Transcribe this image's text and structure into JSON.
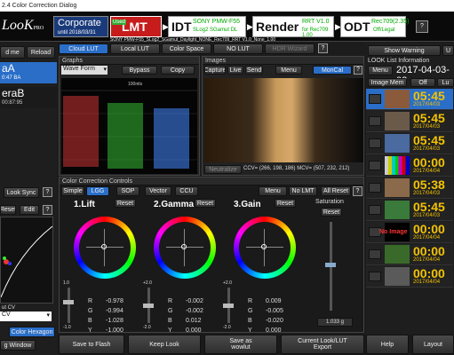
{
  "window": {
    "title": "2.4 Color Correction Dialog"
  },
  "header": {
    "logo": "LooK",
    "logo_suffix": "PRO",
    "product": "Corporate",
    "until": "until 2018/03/31",
    "lmt": {
      "label": "LMT",
      "badge": "Used",
      "value": "Neutral"
    },
    "idt": {
      "label": "IDT",
      "value": "SONY PMW-F55",
      "sub": "SLog2 SGamut DL"
    },
    "render": {
      "label": "Render",
      "value": "RRT V1.0",
      "sub": "for Rec709 1.00"
    },
    "odt": {
      "label": "ODT",
      "value": "Rec709(2.35)",
      "sub": "Off/Legal"
    },
    "path": "SONY PMW-F55_SLog2_SGamut_Daylight_NONE_Rec709_RRT V1.0_None_1.00",
    "help_glyph": "?"
  },
  "left": {
    "buttons": [
      "d me",
      "Reload"
    ],
    "items": [
      {
        "name": "aA",
        "tc": "0:47 BA"
      },
      {
        "name": "eraB",
        "tc": "00:87:95"
      }
    ],
    "look_sync": "Look Sync",
    "reset": "Reset",
    "edit": "Edit",
    "select_value": "CV",
    "color_hexagon": "Color Hexagon",
    "window_label": "g Window",
    "curve_label": "ut CV"
  },
  "tabs": [
    {
      "label": "Cloud LUT"
    },
    {
      "label": "Local LUT"
    },
    {
      "label": "Color Space"
    },
    {
      "label": "NO LUT"
    },
    {
      "label": "HDR Wizard"
    }
  ],
  "graphs": {
    "title": "Graphs",
    "type": "Wave Form",
    "bypass": "Bypass",
    "copy": "Copy",
    "scale": "100nits"
  },
  "images": {
    "title": "Images",
    "capture": "Capture",
    "live": "Live",
    "send": "Send",
    "menu": "Menu",
    "moncal": "MonCal",
    "neutralize": "Neutralize",
    "ccv": "CCV= (266, 198, 186) MCV= (507, 232, 212)"
  },
  "cc": {
    "title": "Color Correction Controls",
    "tabs": [
      "Simple",
      "LGG",
      "SOP",
      "Vector",
      "CCU"
    ],
    "menu": "Menu",
    "no_lmt": "No LMT",
    "all_reset": "All Reset",
    "wheels": [
      {
        "title": "1.Lift",
        "reset": "Reset",
        "r": "-0.978",
        "g": "-0.994",
        "b": "-1.028",
        "y": "-1.000",
        "max": "1.0",
        "min": "-1.0",
        "zero": "0"
      },
      {
        "title": "2.Gamma",
        "reset": "Reset",
        "r": "-0.002",
        "g": "-0.002",
        "b": "0.012",
        "y": "0.000",
        "max": "+2.0",
        "min": "-2.0",
        "zero": "0"
      },
      {
        "title": "3.Gain",
        "reset": "Reset",
        "r": "0.009",
        "g": "-0.005",
        "b": "-0.020",
        "y": "0.000",
        "max": "+2.0",
        "min": "-2.0",
        "zero": "0"
      }
    ],
    "channel_labels": {
      "r": "R",
      "g": "G",
      "b": "B",
      "y": "Y"
    },
    "saturation": {
      "label": "Saturation",
      "reset": "Reset",
      "value": "1.033 g"
    }
  },
  "right": {
    "show_warning": "Show Warning",
    "up": "U",
    "info_title": "LOOK List Information",
    "menu": "Menu",
    "date": "2017-04-03-02",
    "image_mem": "Image Mem",
    "off": "Off",
    "lu": "Lu",
    "looks": [
      {
        "tc": "05:45",
        "date": "2017/04/03",
        "thumb": "#8a5a3a"
      },
      {
        "tc": "05:45",
        "date": "2017/04/03",
        "thumb": "#6a5a4a"
      },
      {
        "tc": "05:45",
        "date": "2017/04/03",
        "thumb": "#4a6aa0"
      },
      {
        "tc": "00:00",
        "date": "2017/04/04",
        "thumb": "bars"
      },
      {
        "tc": "05:38",
        "date": "2017/04/03",
        "thumb": "#8a6a4a"
      },
      {
        "tc": "05:45",
        "date": "2017/04/03",
        "thumb": "#3a7a3a"
      },
      {
        "tc": "00:00",
        "date": "2017/04/04",
        "thumb": "noimg",
        "noimage": "No Image"
      },
      {
        "tc": "00:00",
        "date": "2017/04/04",
        "thumb": "#3a6a2a"
      },
      {
        "tc": "00:00",
        "date": "2017/04/04",
        "thumb": "#5a5a5a"
      }
    ]
  },
  "bottom": {
    "save_flash": "Save to Flash",
    "keep_look": "Keep Look",
    "save_wowlut_1": "Save as",
    "save_wowlut_2": "wowlut",
    "current_1": "Current Look/LUT",
    "current_2": "Export",
    "help": "Help",
    "layout": "Layout"
  }
}
